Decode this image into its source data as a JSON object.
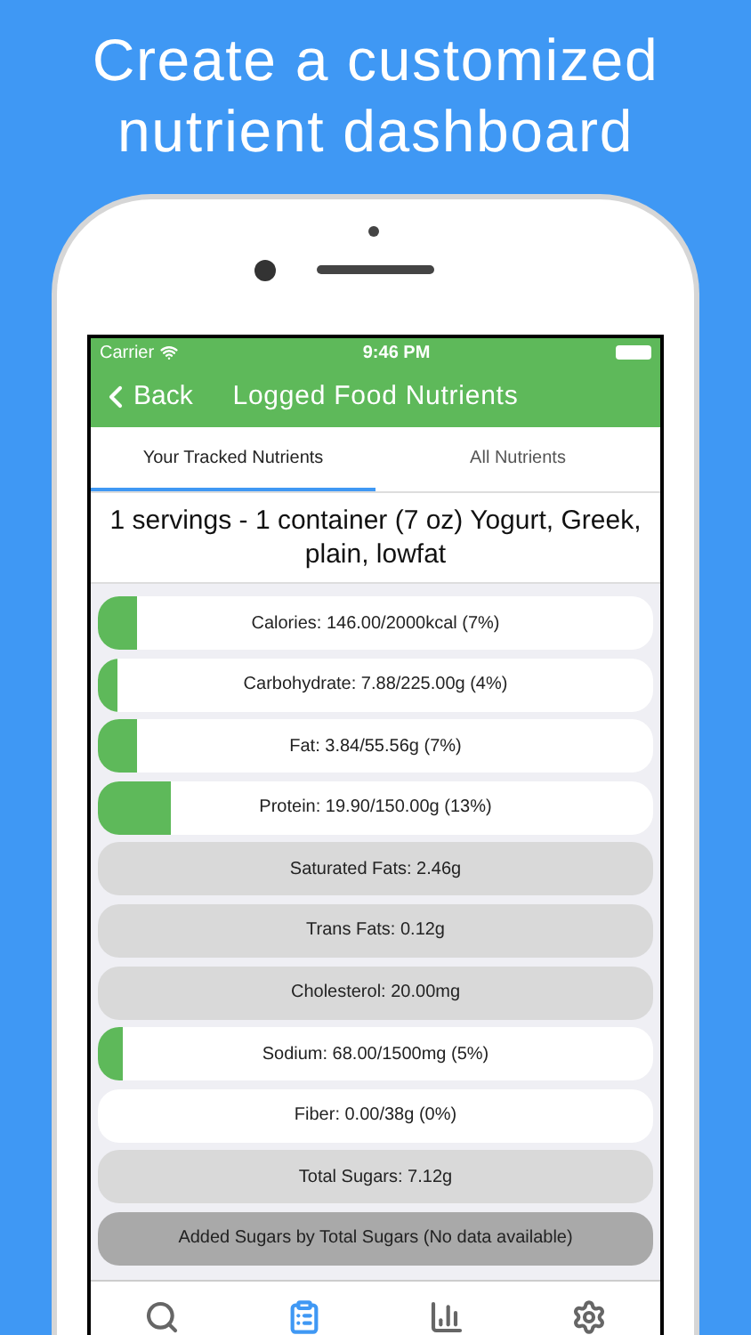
{
  "headline": "Create a customized nutrient dashboard",
  "status_bar": {
    "carrier": "Carrier",
    "time": "9:46 PM"
  },
  "nav_bar": {
    "back": "Back",
    "title": "Logged Food Nutrients"
  },
  "tabs": [
    {
      "label": "Your Tracked Nutrients",
      "selected": true
    },
    {
      "label": "All Nutrients",
      "selected": false
    }
  ],
  "food_title": "1 servings - 1 container (7 oz) Yogurt, Greek, plain, lowfat",
  "nutrients": [
    {
      "kind": "tracked",
      "label": "Calories: 146.00/2000kcal (7%)",
      "level": 0.07
    },
    {
      "kind": "tracked",
      "label": "Carbohydrate: 7.88/225.00g (4%)",
      "level": 0.035
    },
    {
      "kind": "tracked",
      "label": "Fat: 3.84/55.56g (7%)",
      "level": 0.07
    },
    {
      "kind": "tracked",
      "label": "Protein: 19.90/150.00g (13%)",
      "level": 0.13
    },
    {
      "kind": "info",
      "label": "Saturated Fats: 2.46g"
    },
    {
      "kind": "info",
      "label": "Trans Fats: 0.12g"
    },
    {
      "kind": "info",
      "label": "Cholesterol: 20.00mg"
    },
    {
      "kind": "tracked",
      "label": "Sodium: 68.00/1500mg (5%)",
      "level": 0.045
    },
    {
      "kind": "tracked",
      "label": "Fiber: 0.00/38g (0%)"
    },
    {
      "kind": "info",
      "label": "Total Sugars: 7.12g"
    },
    {
      "kind": "unavailable",
      "label": "Added Sugars by Total Sugars (No data available)"
    }
  ],
  "tab_bar": [
    {
      "kind": "search",
      "selected": false
    },
    {
      "kind": "clipboard",
      "selected": true
    },
    {
      "kind": "chart",
      "selected": false
    },
    {
      "kind": "settings",
      "selected": false
    }
  ]
}
